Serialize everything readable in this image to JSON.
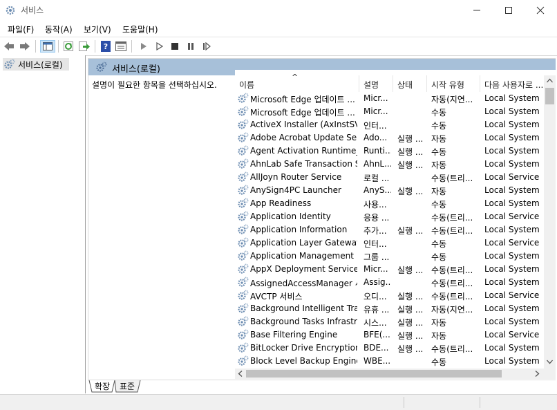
{
  "window": {
    "title": "서비스",
    "min_label": "—",
    "max_label": "☐",
    "close_label": "✕"
  },
  "menu": [
    "파일(F)",
    "동작(A)",
    "보기(V)",
    "도움말(H)"
  ],
  "tree": {
    "root_label": "서비스(로컬)"
  },
  "panel": {
    "header": "서비스(로컬)",
    "description": "설명이 필요한 항목을 선택하십시오."
  },
  "columns": [
    "이름",
    "설명",
    "상태",
    "시작 유형",
    "다음 사용자로 ..."
  ],
  "sort_indicator": "^",
  "rows": [
    {
      "name": "Microsoft Edge 업데이트 ...",
      "desc": "Micr...",
      "status": "",
      "startup": "자동(지연...",
      "logon": "Local System"
    },
    {
      "name": "Microsoft Edge 업데이트 ...",
      "desc": "Micr...",
      "status": "",
      "startup": "수동",
      "logon": "Local System"
    },
    {
      "name": "ActiveX Installer (AxInstSV)",
      "desc": "인터...",
      "status": "",
      "startup": "수동",
      "logon": "Local System"
    },
    {
      "name": "Adobe Acrobat Update Ser...",
      "desc": "Ado...",
      "status": "실행 ...",
      "startup": "자동",
      "logon": "Local System"
    },
    {
      "name": "Agent Activation Runtime_...",
      "desc": "Runti...",
      "status": "실행 ...",
      "startup": "수동",
      "logon": "Local System"
    },
    {
      "name": "AhnLab Safe Transaction S...",
      "desc": "AhnL...",
      "status": "실행 ...",
      "startup": "자동",
      "logon": "Local System"
    },
    {
      "name": "AllJoyn Router Service",
      "desc": "로컬 ...",
      "status": "",
      "startup": "수동(트리...",
      "logon": "Local Service"
    },
    {
      "name": "AnySign4PC Launcher",
      "desc": "AnyS...",
      "status": "실행 ...",
      "startup": "자동",
      "logon": "Local System"
    },
    {
      "name": "App Readiness",
      "desc": "사용...",
      "status": "",
      "startup": "수동",
      "logon": "Local System"
    },
    {
      "name": "Application Identity",
      "desc": "응용 ...",
      "status": "",
      "startup": "수동(트리...",
      "logon": "Local Service"
    },
    {
      "name": "Application Information",
      "desc": "추가...",
      "status": "실행 ...",
      "startup": "수동(트리...",
      "logon": "Local System"
    },
    {
      "name": "Application Layer Gateway ...",
      "desc": "인터...",
      "status": "",
      "startup": "수동",
      "logon": "Local Service"
    },
    {
      "name": "Application Management",
      "desc": "그룹 ...",
      "status": "",
      "startup": "수동",
      "logon": "Local System"
    },
    {
      "name": "AppX Deployment Service ...",
      "desc": "Micr...",
      "status": "실행 ...",
      "startup": "수동(트리...",
      "logon": "Local System"
    },
    {
      "name": "AssignedAccessManager 서...",
      "desc": "Assig...",
      "status": "",
      "startup": "수동(트리...",
      "logon": "Local System"
    },
    {
      "name": "AVCTP 서비스",
      "desc": "오디...",
      "status": "실행 ...",
      "startup": "수동(트리...",
      "logon": "Local Service"
    },
    {
      "name": "Background Intelligent Tra...",
      "desc": "유휴 ...",
      "status": "실행 ...",
      "startup": "자동(지연...",
      "logon": "Local System"
    },
    {
      "name": "Background Tasks Infrastru...",
      "desc": "시스...",
      "status": "실행 ...",
      "startup": "자동",
      "logon": "Local System"
    },
    {
      "name": "Base Filtering Engine",
      "desc": "BFE(...",
      "status": "실행 ...",
      "startup": "자동",
      "logon": "Local Service"
    },
    {
      "name": "BitLocker Drive Encryption ...",
      "desc": "BDE...",
      "status": "실행 ...",
      "startup": "수동(트리...",
      "logon": "Local System"
    },
    {
      "name": "Block Level Backup Engine ...",
      "desc": "WBE...",
      "status": "",
      "startup": "수동",
      "logon": "Local System"
    }
  ],
  "tabs": [
    "확장",
    "표준"
  ],
  "icons": {
    "toolbar": [
      "back-icon",
      "forward-icon",
      "console-tree-icon",
      "refresh-icon",
      "export-icon",
      "help-icon",
      "properties-icon",
      "play-icon",
      "play-alt-icon",
      "stop-icon",
      "pause-icon",
      "resume-icon"
    ],
    "service": "gear-icon"
  },
  "colors": {
    "header_blue": "#a7c0d9",
    "icon_green": "#3a9b3a",
    "help_blue": "#2b4ea8"
  }
}
